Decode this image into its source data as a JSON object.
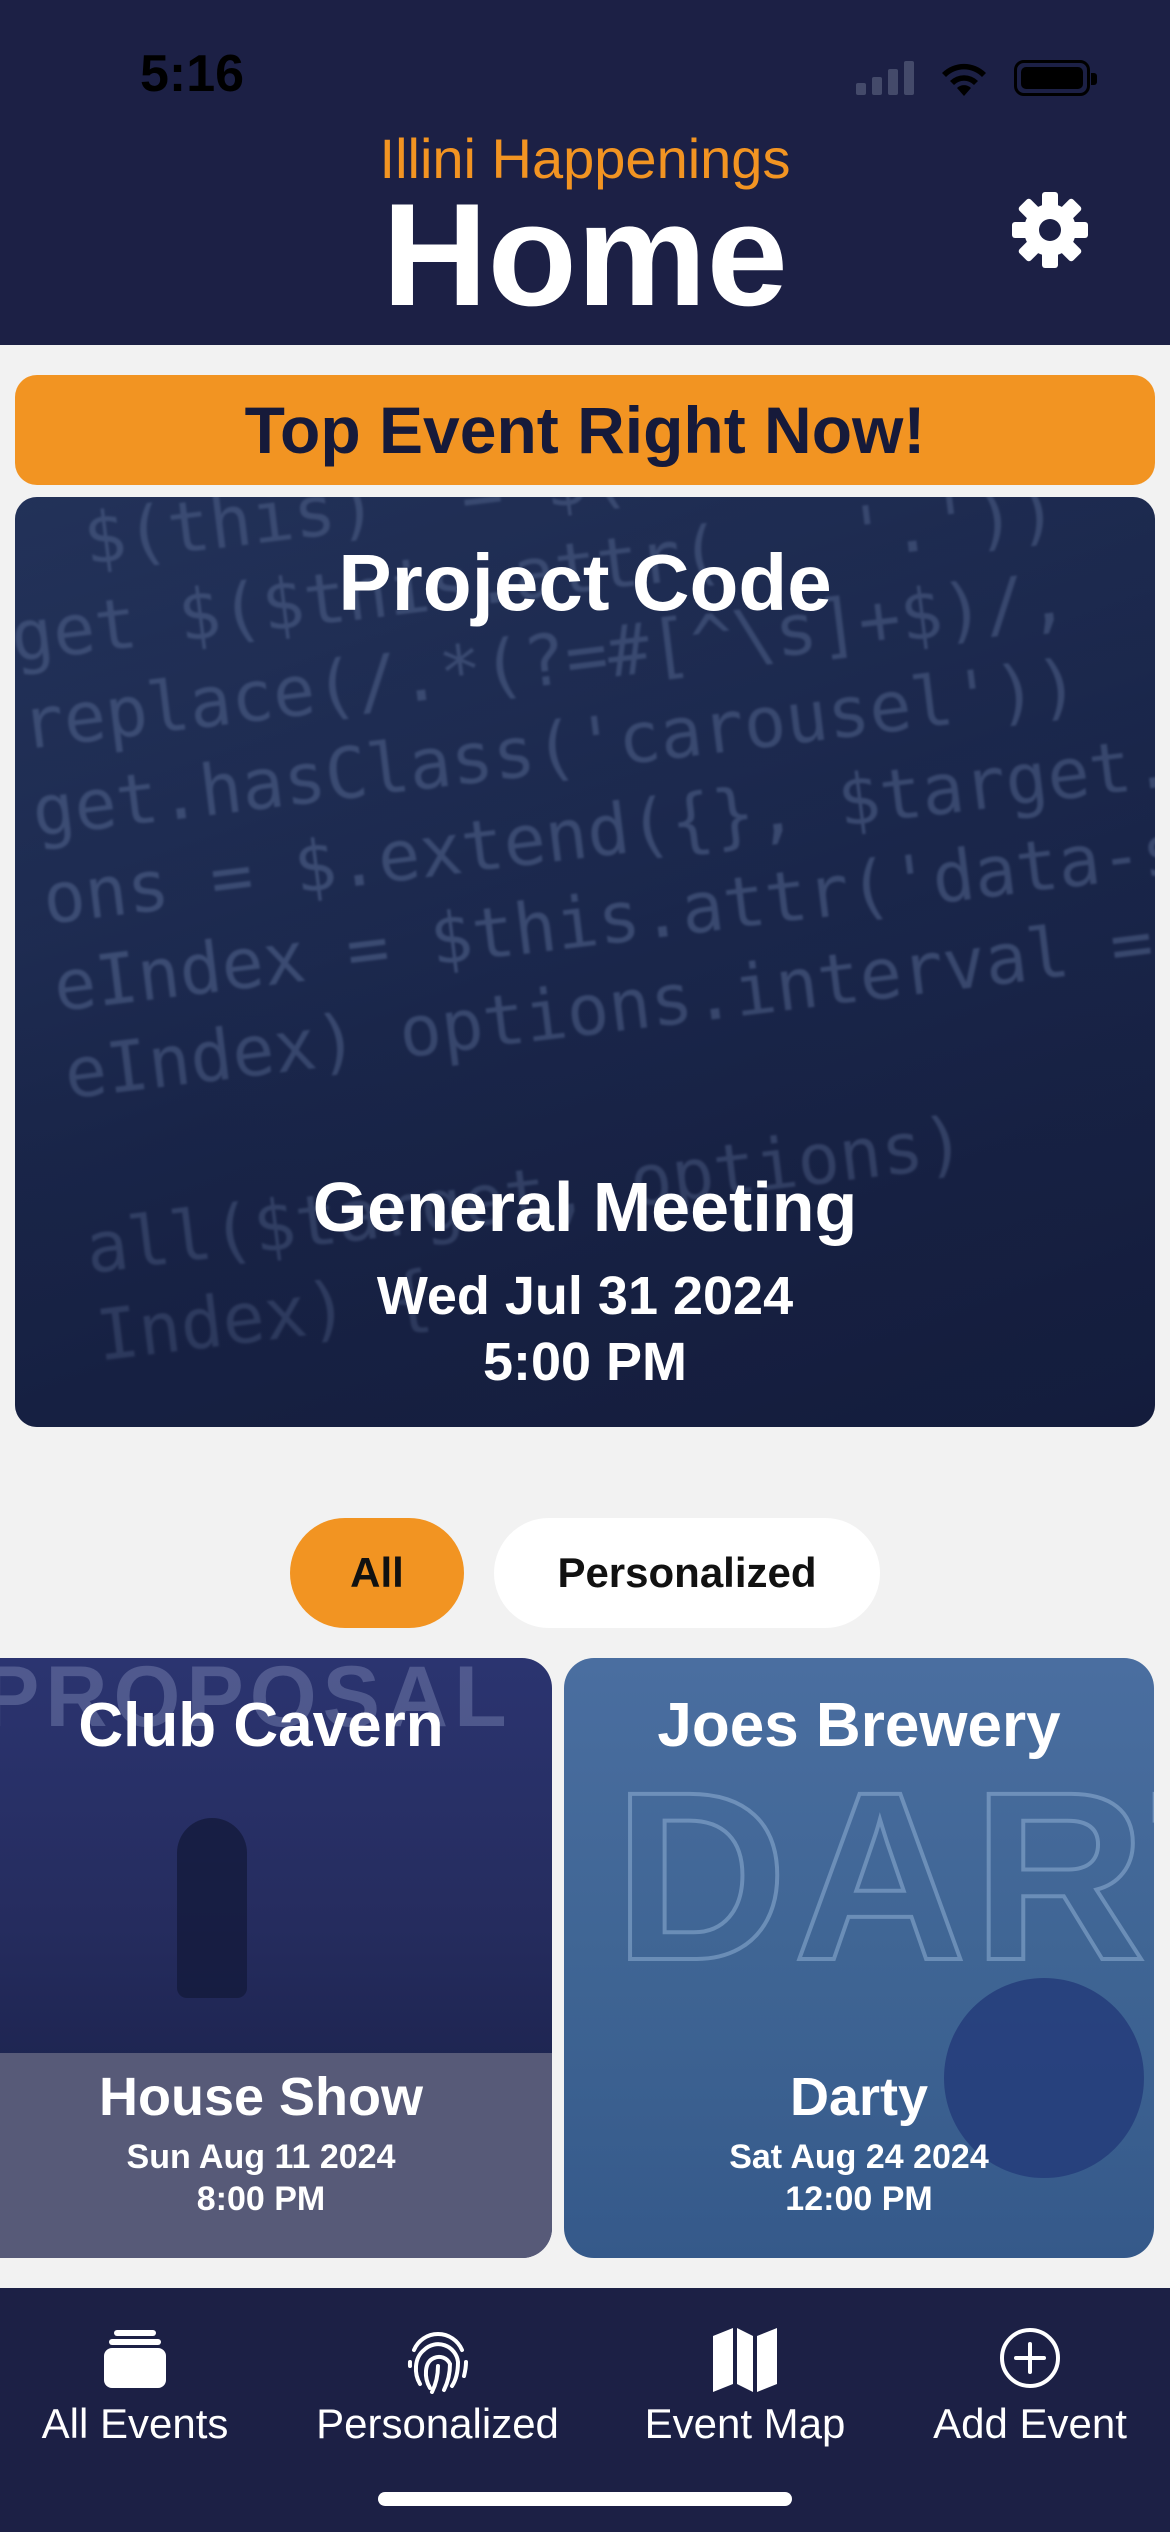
{
  "status_bar": {
    "time": "5:16"
  },
  "header": {
    "app_name": "Illini Happenings",
    "title": "Home"
  },
  "top_event": {
    "banner": "Top Event Right Now!",
    "club": "Project Code",
    "name": "General Meeting",
    "date": "Wed Jul 31 2024",
    "time": "5:00 PM"
  },
  "filters": {
    "options": [
      "All",
      "Personalized"
    ],
    "selected": "All"
  },
  "events": [
    {
      "club": "Club Cavern",
      "name": "House Show",
      "date": "Sun Aug 11 2024",
      "time": "8:00 PM"
    },
    {
      "club": "Joes Brewery",
      "name": "Darty",
      "date": "Sat Aug 24 2024",
      "time": "12:00 PM"
    }
  ],
  "tabs": [
    {
      "label": "All Events",
      "icon": "stack-icon"
    },
    {
      "label": "Personalized",
      "icon": "fingerprint-icon"
    },
    {
      "label": "Event Map",
      "icon": "map-icon"
    },
    {
      "label": "Add Event",
      "icon": "plus-circle-icon"
    }
  ],
  "colors": {
    "navy": "#1c2045",
    "accent_orange": "#f29422",
    "background": "#f2f2f2"
  }
}
